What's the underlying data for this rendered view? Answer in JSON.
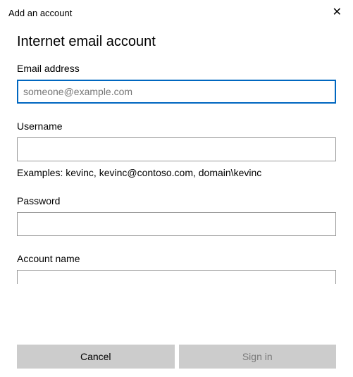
{
  "window": {
    "title": "Add an account",
    "close_icon": "✕"
  },
  "heading": "Internet email account",
  "fields": {
    "email": {
      "label": "Email address",
      "placeholder": "someone@example.com",
      "value": ""
    },
    "username": {
      "label": "Username",
      "value": "",
      "helper": "Examples: kevinc, kevinc@contoso.com, domain\\kevinc"
    },
    "password": {
      "label": "Password",
      "value": ""
    },
    "account_name": {
      "label": "Account name",
      "value": ""
    }
  },
  "buttons": {
    "cancel": "Cancel",
    "signin": "Sign in"
  }
}
